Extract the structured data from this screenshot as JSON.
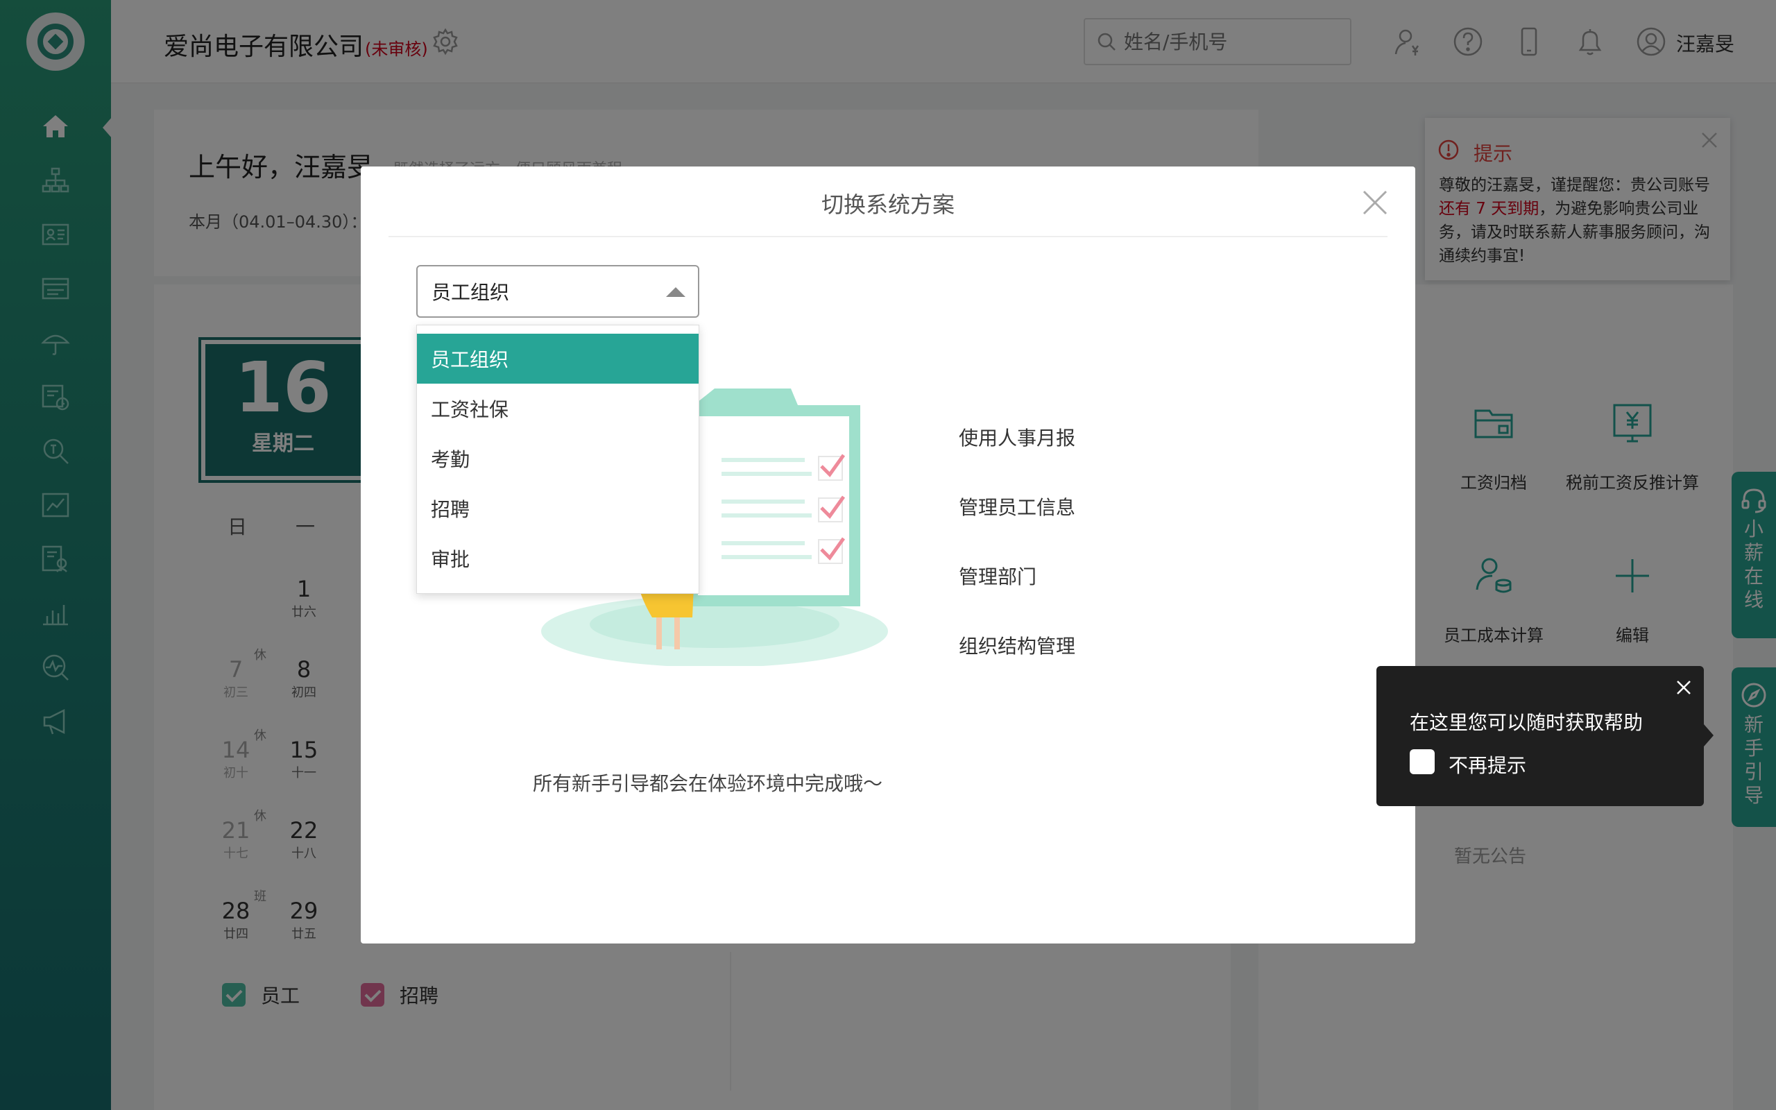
{
  "topbar": {
    "company": "爱尚电子有限公司",
    "status": "(未审核)",
    "search_placeholder": "姓名/手机号",
    "user_name": "汪嘉旻"
  },
  "greeting": {
    "title": "上午好，汪嘉旻",
    "subtitle": "既然选择了远方，便只顾风雨兼程",
    "month": "本月（04.01–04.30）："
  },
  "calendar": {
    "day": "16",
    "weekday": "星期二",
    "headers": [
      "日",
      "一"
    ],
    "days": [
      {
        "n": "1",
        "l": "廿六"
      },
      {
        "n": "7",
        "l": "初三",
        "tag": "休"
      },
      {
        "n": "8",
        "l": "初四"
      },
      {
        "n": "14",
        "l": "初十",
        "tag": "休"
      },
      {
        "n": "15",
        "l": "十一"
      },
      {
        "n": "21",
        "l": "十七",
        "tag": "休"
      },
      {
        "n": "22",
        "l": "十八"
      },
      {
        "n": "28",
        "l": "廿四",
        "tag": "班"
      },
      {
        "n": "29",
        "l": "廿五"
      }
    ],
    "legend_employee": "员工",
    "legend_recruit": "招聘"
  },
  "tools": {
    "salary_archive": "工资归档",
    "pretax_calc": "税前工资反推计算",
    "cost_calc": "员工成本计算",
    "edit": "编辑"
  },
  "notice": {
    "title": "提示",
    "body_prefix": "尊敬的汪嘉旻，谨提醒您：贵公司账号 ",
    "body_red": "还有 7 天到期",
    "body_suffix": "，为避免影响贵公司业务，请及时联系薪人薪事服务顾问，沟通续约事宜!"
  },
  "no_announcement": "暂无公告",
  "side_tabs": {
    "online": "小薪在线",
    "guide": "新手引导"
  },
  "modal": {
    "title": "切换系统方案",
    "selected": "员工组织",
    "options": [
      "员工组织",
      "工资社保",
      "考勤",
      "招聘",
      "审批"
    ],
    "features": [
      "使用人事月报",
      "管理员工信息",
      "管理部门",
      "组织结构管理"
    ],
    "caption": "所有新手引导都会在体验环境中完成哦～"
  },
  "tooltip": {
    "text": "在这里您可以随时获取帮助",
    "checkbox_label": "不再提示"
  },
  "colors": {
    "brand": "#27a596",
    "sidebar": "#1d7f74",
    "alert": "#d0021b"
  }
}
